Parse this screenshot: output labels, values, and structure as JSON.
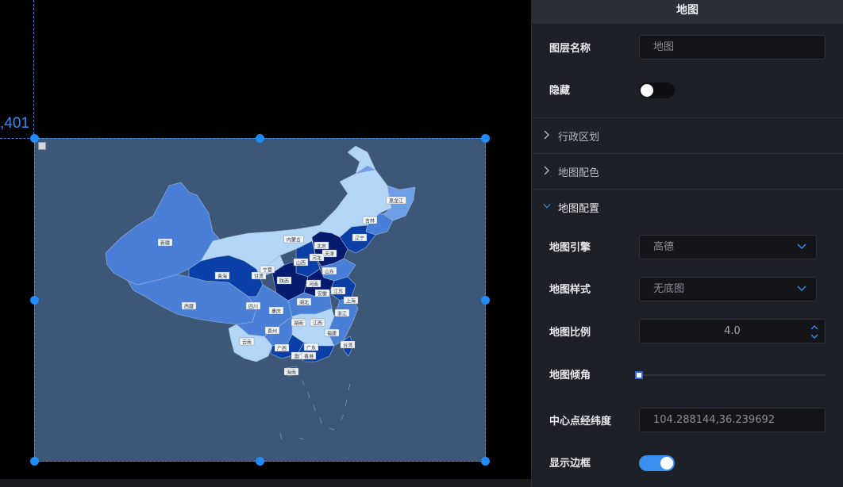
{
  "canvas": {
    "coord_label": ",401",
    "map": {
      "province_labels": [
        "新疆",
        "西藏",
        "青海",
        "甘肃",
        "内蒙古",
        "黑龙江",
        "吉林",
        "辽宁",
        "北京",
        "天津",
        "河北",
        "山西",
        "山东",
        "陕西",
        "宁夏",
        "四川",
        "重庆",
        "河南",
        "湖北",
        "安徽",
        "江苏",
        "上海",
        "浙江",
        "湖南",
        "江西",
        "福建",
        "贵州",
        "云南",
        "广西",
        "广东",
        "台湾",
        "海南",
        "澳门",
        "香港"
      ]
    }
  },
  "panel": {
    "title": "地图",
    "layer_name": {
      "label": "图层名称",
      "value": "地图"
    },
    "hidden": {
      "label": "隐藏",
      "on": false
    },
    "sections": {
      "admin_division": "行政区划",
      "map_color": "地图配色",
      "map_config": "地图配置"
    },
    "engine": {
      "label": "地图引擎",
      "value": "高德"
    },
    "style": {
      "label": "地图样式",
      "value": "无底图"
    },
    "scale": {
      "label": "地图比例",
      "value": "4.0"
    },
    "tilt": {
      "label": "地图倾角",
      "value": 0
    },
    "center": {
      "label": "中心点经纬度",
      "value": "104.288144,36.239692"
    },
    "border": {
      "label": "显示边框",
      "on": true
    }
  },
  "colors": {
    "accent": "#1f8cf8",
    "map_bg": "#3c5777",
    "light_blue": "#b3d6f7",
    "mid_blue": "#4a7fd8",
    "dark_blue": "#0a3fa8",
    "navy": "#061a6e"
  }
}
